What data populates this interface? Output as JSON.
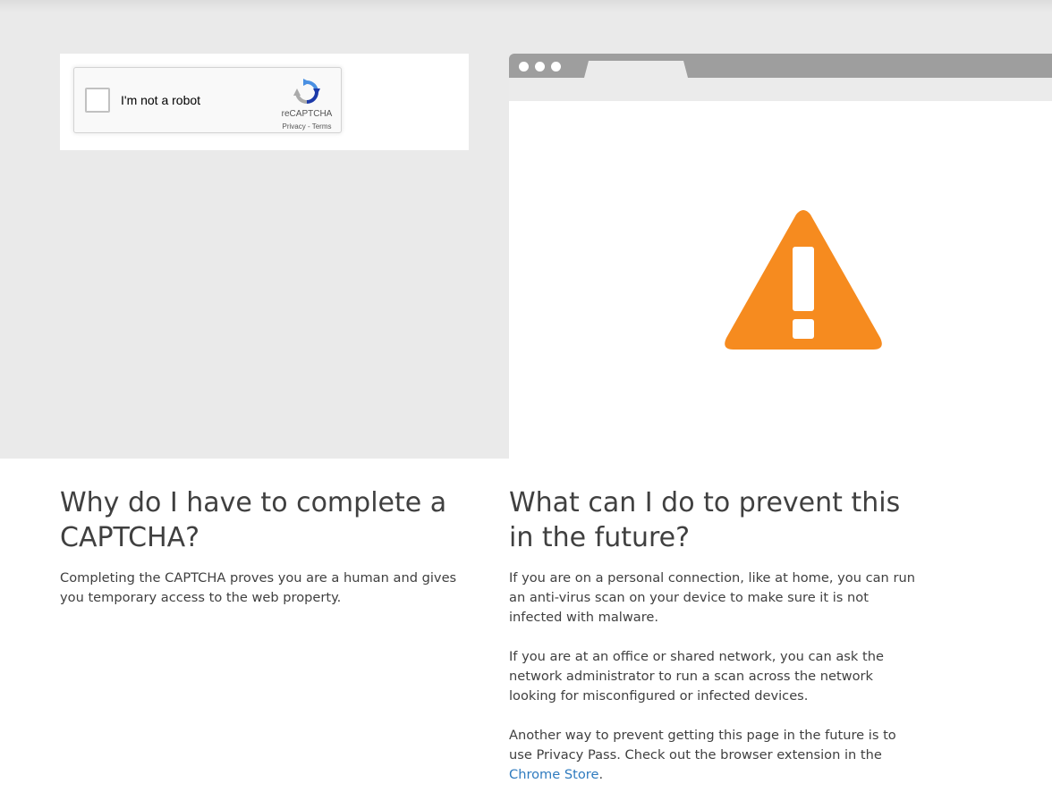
{
  "captcha": {
    "checkbox_label": "I'm not a robot",
    "brand": "reCAPTCHA",
    "privacy_label": "Privacy",
    "separator": " - ",
    "terms_label": "Terms"
  },
  "browser_illustration": {
    "icon": "warning-triangle-icon",
    "icon_color": "#f68b1f"
  },
  "why": {
    "heading": "Why do I have to complete a CAPTCHA?",
    "body": "Completing the CAPTCHA proves you are a human and gives you temporary access to the web property."
  },
  "prevent": {
    "heading": "What can I do to prevent this in the future?",
    "paragraph1": "If you are on a personal connection, like at home, you can run an anti-virus scan on your device to make sure it is not infected with malware.",
    "paragraph2": "If you are at an office or shared network, you can ask the network administrator to run a scan across the network looking for misconfigured or infected devices.",
    "paragraph3_prefix": "Another way to prevent getting this page in the future is to use Privacy Pass. Check out the browser extension in the ",
    "chrome_store_link": "Chrome Store",
    "paragraph3_suffix": "."
  },
  "colors": {
    "background_band": "#eaeaea",
    "text": "#404040",
    "link": "#2f7bbf",
    "warning": "#f68b1f"
  }
}
